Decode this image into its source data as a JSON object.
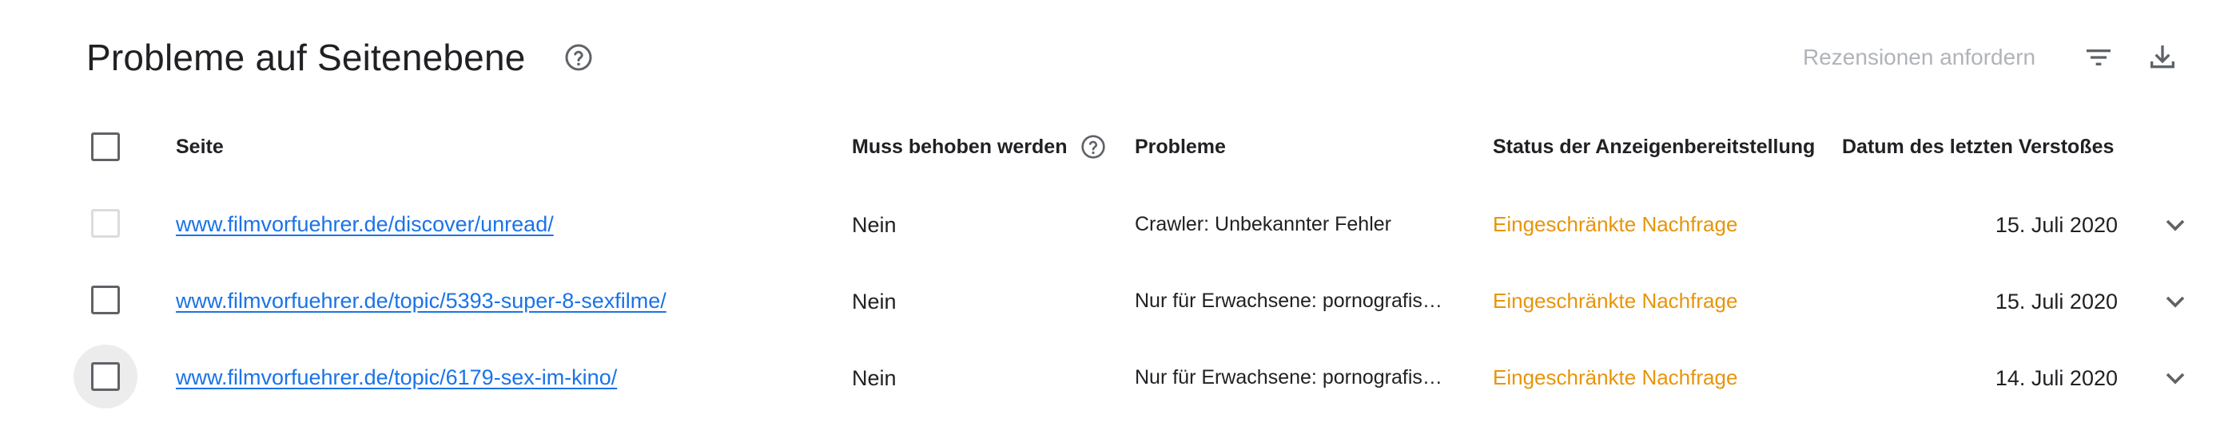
{
  "header": {
    "title": "Probleme auf Seitenebene",
    "request_review_label": "Rezensionen anfordern"
  },
  "table": {
    "columns": {
      "seite": "Seite",
      "muss": "Muss behoben werden",
      "probleme": "Probleme",
      "status": "Status der Anzeigenbereitstellung",
      "datum": "Datum des letzten Verstoßes"
    },
    "rows": [
      {
        "url": "www.filmvorfuehrer.de/discover/unread/",
        "muss": "Nein",
        "probleme": "Crawler: Unbekannter Fehler",
        "status": "Eingeschränkte Nachfrage",
        "datum": "15. Juli 2020",
        "checkbox_disabled": true
      },
      {
        "url": "www.filmvorfuehrer.de/topic/5393-super-8-sexfilme/",
        "muss": "Nein",
        "probleme": "Nur für Erwachsene: pornografis…",
        "status": "Eingeschränkte Nachfrage",
        "datum": "15. Juli 2020",
        "checkbox_disabled": false
      },
      {
        "url": "www.filmvorfuehrer.de/topic/6179-sex-im-kino/",
        "muss": "Nein",
        "probleme": "Nur für Erwachsene: pornografis…",
        "status": "Eingeschränkte Nachfrage",
        "datum": "14. Juli 2020",
        "checkbox_disabled": false
      }
    ]
  },
  "colors": {
    "link": "#1a73e8",
    "status_warning": "#e8940a",
    "disabled_text": "#b0b3b8"
  },
  "icons": {
    "help": "help-circle-icon",
    "filter": "filter-list-icon",
    "download": "download-icon",
    "expand": "chevron-down-icon"
  }
}
